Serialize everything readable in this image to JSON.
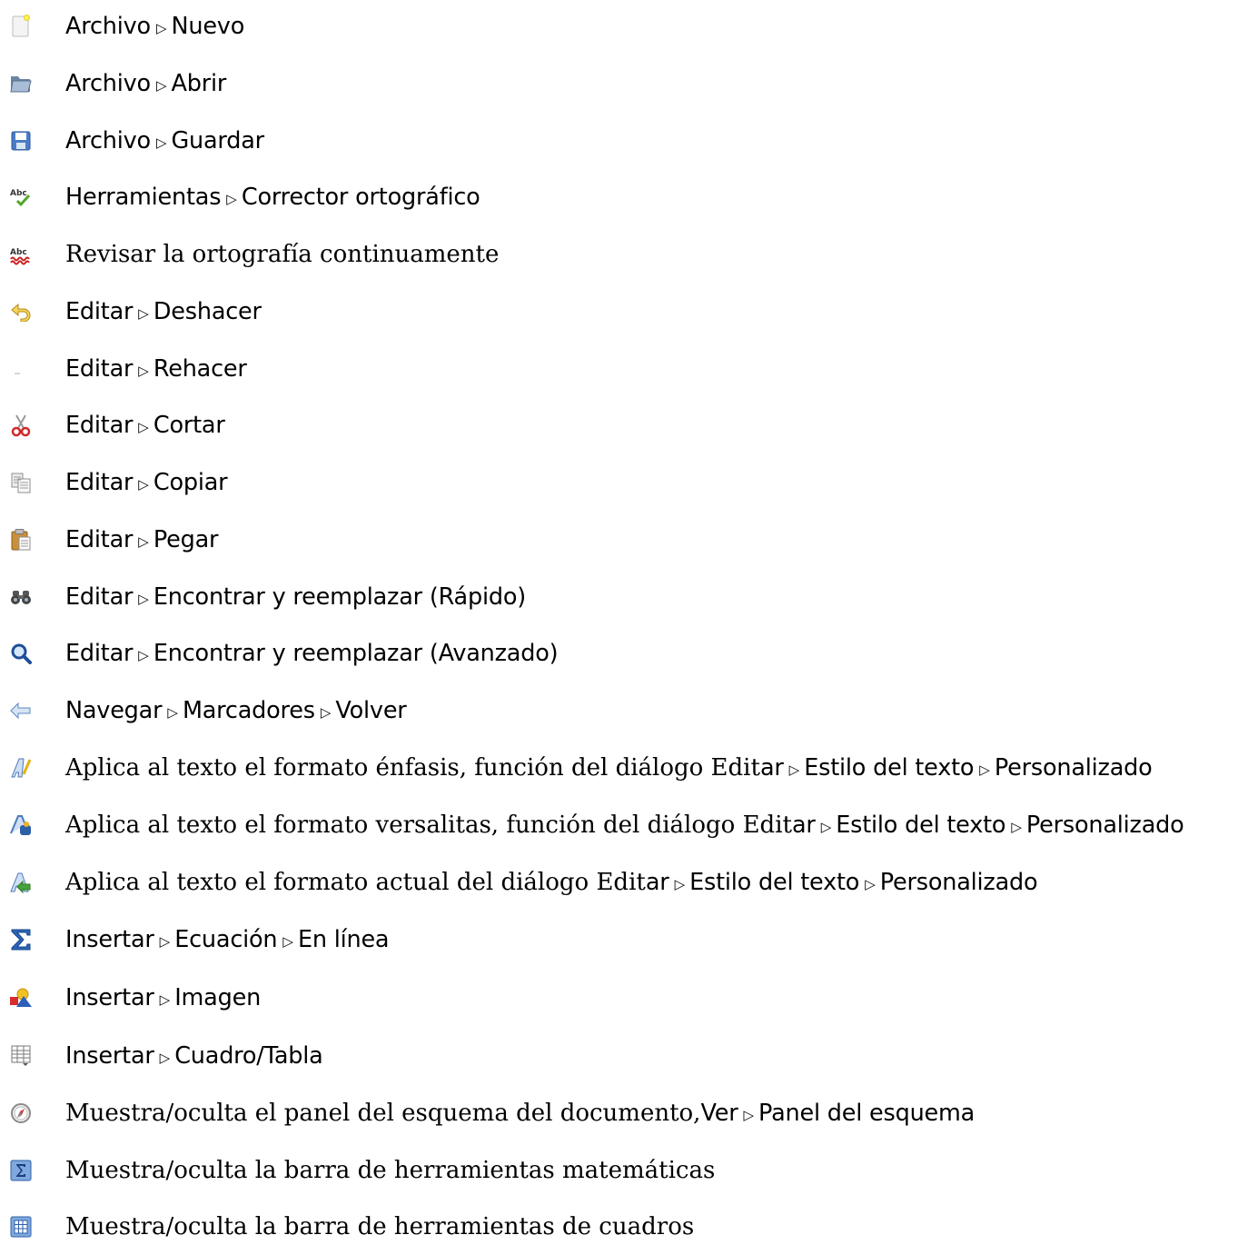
{
  "items": [
    {
      "icon": "new-document-icon",
      "parts": [
        "Archivo",
        "Nuevo"
      ]
    },
    {
      "icon": "open-folder-icon",
      "parts": [
        "Archivo",
        "Abrir"
      ]
    },
    {
      "icon": "save-floppy-icon",
      "parts": [
        "Archivo",
        "Guardar"
      ]
    },
    {
      "icon": "spellcheck-icon",
      "parts": [
        "Herramientas",
        "Corrector ortográfico"
      ]
    },
    {
      "icon": "continuous-spellcheck-icon",
      "desc": "Revisar la ortografía continuamente"
    },
    {
      "icon": "undo-icon",
      "parts": [
        "Editar",
        "Deshacer"
      ]
    },
    {
      "icon": "redo-icon",
      "parts": [
        "Editar",
        "Rehacer"
      ]
    },
    {
      "icon": "scissors-icon",
      "parts": [
        "Editar",
        "Cortar"
      ]
    },
    {
      "icon": "copy-icon",
      "parts": [
        "Editar",
        "Copiar"
      ]
    },
    {
      "icon": "paste-clipboard-icon",
      "parts": [
        "Editar",
        "Pegar"
      ]
    },
    {
      "icon": "binoculars-icon",
      "parts": [
        "Editar",
        "Encontrar y reemplazar (Rápido)"
      ]
    },
    {
      "icon": "magnifier-icon",
      "parts": [
        "Editar",
        "Encontrar y reemplazar (Avanzado)"
      ]
    },
    {
      "icon": "back-arrow-icon",
      "parts": [
        "Navegar",
        "Marcadores",
        "Volver"
      ]
    },
    {
      "icon": "emphasis-icon",
      "desc": "Aplica al texto el formato énfasis, función del diálogo Edit",
      "parts": [
        "ar",
        "Estilo del texto",
        "Personalizado"
      ]
    },
    {
      "icon": "small-caps-icon",
      "desc": "Aplica al texto el formato versalitas, función del diálogo Edit",
      "parts": [
        "ar",
        "Estilo del texto",
        "Personalizado"
      ]
    },
    {
      "icon": "apply-style-icon",
      "desc": "Aplica al texto el formato actual del diálogo Edit",
      "parts": [
        "ar",
        "Estilo del texto",
        "Personalizado"
      ]
    },
    {
      "icon": "sigma-icon",
      "parts": [
        "Insertar",
        "Ecuación",
        "En línea"
      ]
    },
    {
      "icon": "insert-image-icon",
      "parts": [
        "Insertar",
        "Imagen"
      ]
    },
    {
      "icon": "table-icon",
      "parts": [
        "Insertar",
        "Cuadro/Tabla"
      ]
    },
    {
      "icon": "compass-icon",
      "desc": "Muestra/oculta el panel del esquema del documento, ",
      "parts": [
        "Ver",
        "Panel del esquema"
      ]
    },
    {
      "icon": "math-toolbar-icon",
      "desc": "Muestra/oculta la barra de herramientas matemáticas"
    },
    {
      "icon": "table-toolbar-icon",
      "desc": "Muestra/oculta la barra de herramientas de cuadros"
    }
  ]
}
